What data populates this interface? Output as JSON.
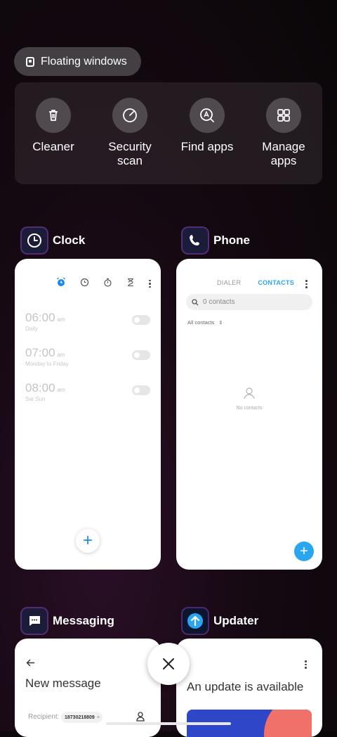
{
  "floating_windows": {
    "label": "Floating windows"
  },
  "tools": [
    {
      "label": "Cleaner",
      "icon": "trash-icon"
    },
    {
      "label": "Security\nscan",
      "icon": "security-scan-icon"
    },
    {
      "label": "Find apps",
      "icon": "find-apps-icon"
    },
    {
      "label": "Manage\napps",
      "icon": "manage-apps-icon"
    }
  ],
  "apps": {
    "clock": {
      "name": "Clock",
      "alarms": [
        {
          "time": "06:00",
          "ampm": "am",
          "repeat": "Daily"
        },
        {
          "time": "07:00",
          "ampm": "am",
          "repeat": "Monday to Friday"
        },
        {
          "time": "08:00",
          "ampm": "am",
          "repeat": "Sat Sun"
        }
      ],
      "fab": "+"
    },
    "phone": {
      "name": "Phone",
      "tab_dialer": "DIALER",
      "tab_contacts": "CONTACTS",
      "search_placeholder": "0 contacts",
      "filter": "All contacts",
      "empty_text": "No contacts",
      "fab": "+"
    },
    "messaging": {
      "name": "Messaging",
      "title": "New message",
      "recipient_label": "Recipient:",
      "recipient_chip": "18730218809",
      "chip_remove": "×"
    },
    "updater": {
      "name": "Updater",
      "title": "An update is available"
    }
  },
  "colors": {
    "accent_blue": "#2aa6f0",
    "clock_blue": "#1e88e5"
  }
}
